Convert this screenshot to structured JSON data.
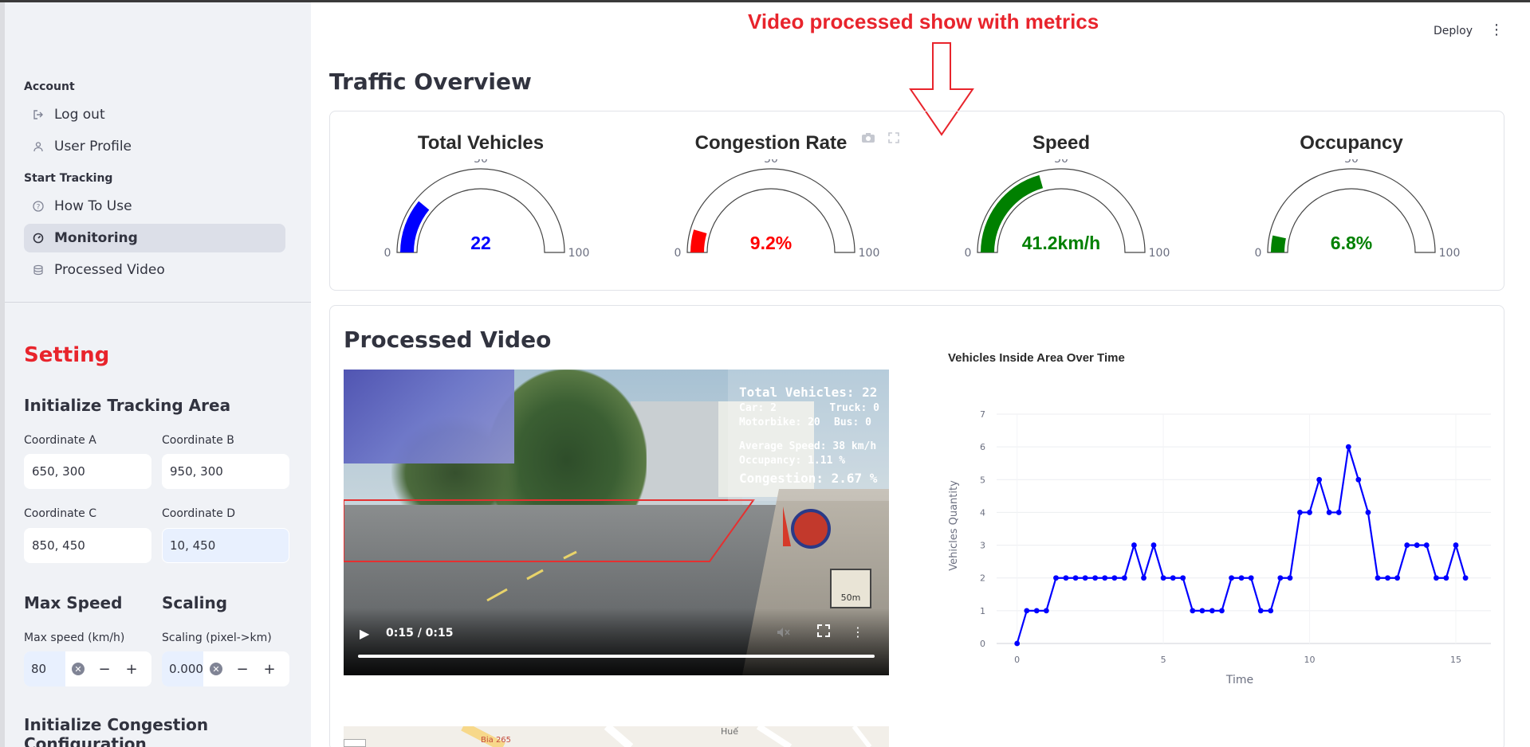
{
  "sidebar": {
    "sections": {
      "account": "Account",
      "start": "Start Tracking"
    },
    "items": [
      {
        "label": "Log out",
        "icon": "logout-icon"
      },
      {
        "label": "User Profile",
        "icon": "user-icon"
      },
      {
        "label": "How To Use",
        "icon": "help-icon"
      },
      {
        "label": "Monitoring",
        "icon": "monitoring-icon",
        "active": true
      },
      {
        "label": "Processed Video",
        "icon": "database-icon"
      }
    ],
    "setting_title": "Setting",
    "tracking_area": {
      "title": "Initialize Tracking Area",
      "a_label": "Coordinate A",
      "a_value": "650, 300",
      "b_label": "Coordinate B",
      "b_value": "950, 300",
      "c_label": "Coordinate C",
      "c_value": "850, 450",
      "d_label": "Coordinate D",
      "d_value": "10, 450"
    },
    "max_speed": {
      "title": "Max Speed",
      "label": "Max speed (km/h)",
      "value": "80"
    },
    "scaling": {
      "title": "Scaling",
      "label": "Scaling (pixel->km)",
      "value": "0.000"
    },
    "congestion_title": "Initialize Congestion Configuration"
  },
  "header": {
    "deploy": "Deploy"
  },
  "annotation": {
    "text": "Video processed show with metrics",
    "color": "#e8242c"
  },
  "overview": {
    "title": "Traffic Overview",
    "gauges": [
      {
        "title": "Total Vehicles",
        "value": 22,
        "display": "22",
        "color": "#0000ff"
      },
      {
        "title": "Congestion Rate",
        "value": 9.2,
        "display": "9.2%",
        "color": "#ff0000"
      },
      {
        "title": "Speed",
        "value": 41.2,
        "display": "41.2km/h",
        "color": "#008000"
      },
      {
        "title": "Occupancy",
        "value": 6.8,
        "display": "6.8%",
        "color": "#008000"
      }
    ],
    "gauge_ticks": {
      "min": "0",
      "mid": "50",
      "max": "100"
    }
  },
  "video_section": {
    "title": "Processed Video",
    "overlay": {
      "total": "Total Vehicles: 22",
      "car": "Car: 2",
      "truck": "Truck: 0",
      "motorbike": "Motorbike: 20",
      "bus": "Bus: 0",
      "avg_speed": "Average Speed: 38 km/h",
      "occupancy": "Occupancy: 1.11 %",
      "congestion": "Congestion: 2.67 %"
    },
    "sign_text": "50m",
    "time": "0:15 / 0:15",
    "progress": 1.0
  },
  "map": {
    "labels": [
      "Bia 265",
      "Huế"
    ]
  },
  "chart_data": {
    "type": "line",
    "title": "Vehicles Inside Area Over Time",
    "xlabel": "Time",
    "ylabel": "Vehicles Quantity",
    "xlim": [
      -0.7,
      16.2
    ],
    "ylim": [
      0,
      7
    ],
    "xticks": [
      0,
      5,
      10,
      15
    ],
    "yticks": [
      0,
      1,
      2,
      3,
      4,
      5,
      6,
      7
    ],
    "color": "#0000ff",
    "x": [
      0,
      0.33,
      0.67,
      1.0,
      1.33,
      1.67,
      2.0,
      2.33,
      2.67,
      3.0,
      3.33,
      3.67,
      4.0,
      4.33,
      4.67,
      5.0,
      5.33,
      5.67,
      6.0,
      6.33,
      6.67,
      7.0,
      7.33,
      7.67,
      8.0,
      8.33,
      8.67,
      9.0,
      9.33,
      9.67,
      10.0,
      10.33,
      10.67,
      11.0,
      11.33,
      11.67,
      12.0,
      12.33,
      12.67,
      13.0,
      13.33,
      13.67,
      14.0,
      14.33,
      14.67,
      15.0,
      15.33
    ],
    "y": [
      0,
      1,
      1,
      1,
      2,
      2,
      2,
      2,
      2,
      2,
      2,
      2,
      3,
      2,
      3,
      2,
      2,
      2,
      1,
      1,
      1,
      1,
      2,
      2,
      2,
      1,
      1,
      2,
      2,
      4,
      4,
      5,
      4,
      4,
      6,
      5,
      4,
      2,
      2,
      2,
      3,
      3,
      3,
      2,
      2,
      3,
      2
    ]
  }
}
